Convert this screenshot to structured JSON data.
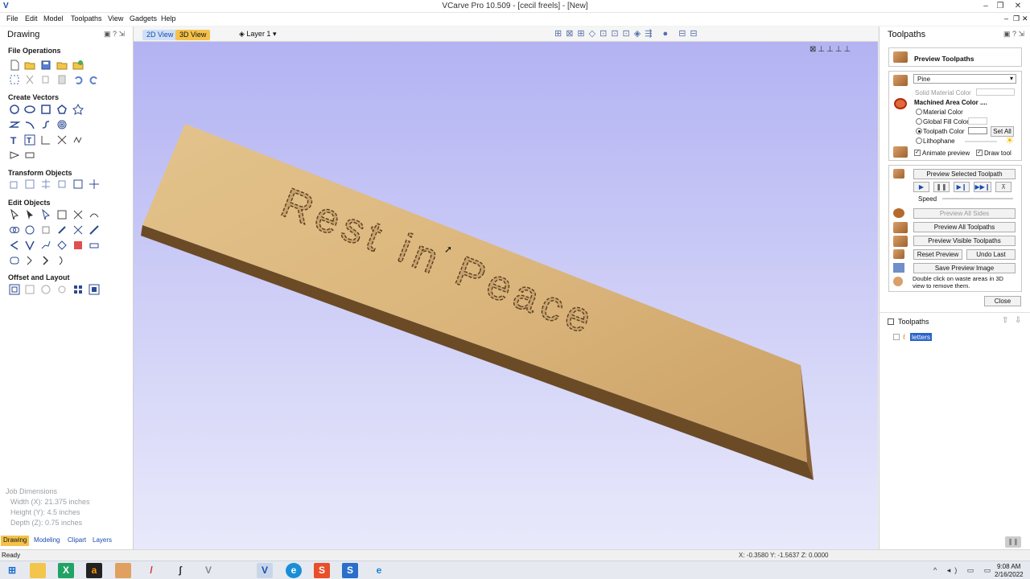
{
  "window": {
    "title": "VCarve Pro 10.509 - [cecil freels] - [New]"
  },
  "menu": [
    "File",
    "Edit",
    "Model",
    "Toolpaths",
    "View",
    "Gadgets",
    "Help"
  ],
  "left_panel": {
    "title": "Drawing",
    "sections": {
      "file_ops": "File Operations",
      "create_vectors": "Create Vectors",
      "transform": "Transform Objects",
      "edit_objects": "Edit Objects",
      "offset_layout": "Offset and Layout"
    },
    "job_dimensions": {
      "heading": "Job Dimensions",
      "width": "Width  (X): 21.375 inches",
      "height": "Height (Y): 4.5 inches",
      "depth": "Depth  (Z): 0.75 inches"
    },
    "tabs": [
      "Drawing",
      "Modeling",
      "Clipart",
      "Layers"
    ]
  },
  "view_bar": {
    "tab_2d": "2D View",
    "tab_3d": "3D View",
    "layer": "Layer 1"
  },
  "board": {
    "text": "Rest in Peace"
  },
  "right_panel": {
    "title": "Toolpaths",
    "preview_header": "Preview Toolpaths",
    "material": "Pine",
    "solid_material_color": "Solid Material Color",
    "machined_area_color": "Machined Area Color ....",
    "radio_material_color": "Material Color",
    "radio_global_fill": "Global Fill Color",
    "radio_toolpath_color": "Toolpath Color",
    "radio_lithophane": "Lithophane",
    "set_all": "Set All",
    "animate_preview": "Animate preview",
    "draw_tool": "Draw tool",
    "preview_selected": "Preview Selected Toolpath",
    "speed": "Speed",
    "preview_all_sides": "Preview All Sides",
    "preview_all_toolpaths": "Preview All Toolpaths",
    "preview_visible_toolpaths": "Preview Visible Toolpaths",
    "reset_preview": "Reset Preview",
    "undo_last": "Undo Last",
    "save_preview_image": "Save Preview Image",
    "hint": "Double click on waste areas in 3D view to remove them.",
    "close": "Close",
    "toolpaths_list_title": "Toolpaths",
    "toolpath_item": "letters"
  },
  "status": {
    "left": "Ready",
    "coords": "X: -0.3580 Y: -1.5637 Z: 0.0000"
  },
  "taskbar": {
    "time": "9:08 AM",
    "date": "2/16/2022"
  },
  "colors": {
    "accent": "#1a4ab0",
    "wood_light": "#e2c08a",
    "wood_dark": "#6b4a26"
  }
}
